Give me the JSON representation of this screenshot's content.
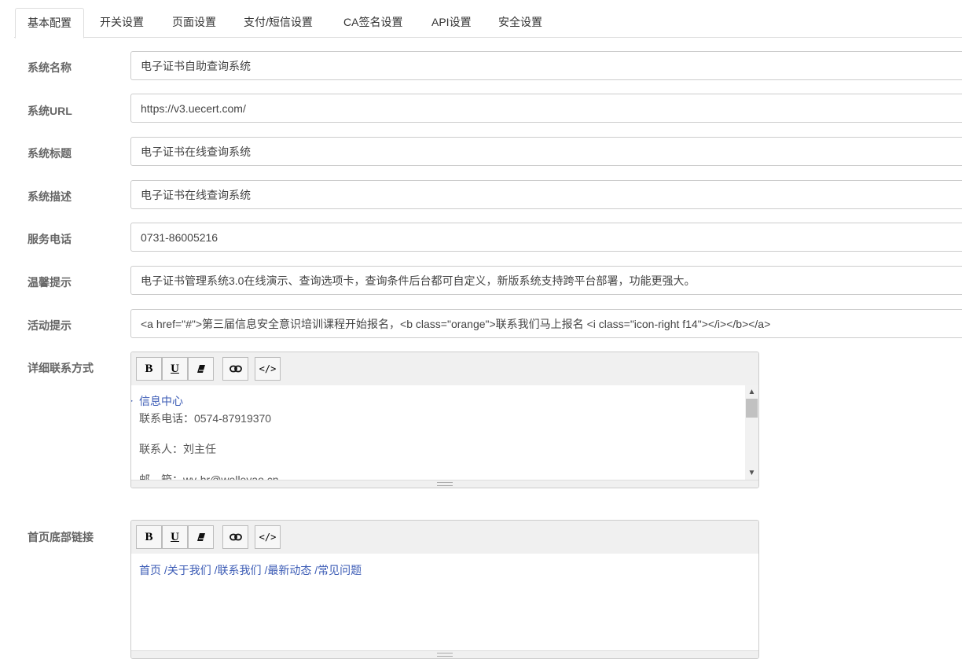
{
  "tabs": [
    "基本配置",
    "开关设置",
    "页面设置",
    "支付/短信设置",
    "CA签名设置",
    "API设置",
    "安全设置"
  ],
  "fields": {
    "system_name": {
      "label": "系统名称",
      "value": "电子证书自助查询系统"
    },
    "system_url": {
      "label": "系统URL",
      "value": "https://v3.uecert.com/"
    },
    "system_title": {
      "label": "系统标题",
      "value": "电子证书在线查询系统"
    },
    "system_desc": {
      "label": "系统描述",
      "value": "电子证书在线查询系统"
    },
    "service_phone": {
      "label": "服务电话",
      "value": "0731-86005216"
    },
    "tips": {
      "label": "温馨提示",
      "value": "电子证书管理系统3.0在线演示、查询选项卡，查询条件后台都可自定义，新版系统支持跨平台部署，功能更强大。"
    },
    "activity": {
      "label": "活动提示",
      "value": "<a href=\"#\">第三届信息安全意识培训课程开始报名，<b class=\"orange\">联系我们马上报名 <i class=\"icon-right f14\"></i></b></a>"
    }
  },
  "contact_editor": {
    "label": "详细联系方式",
    "heading": "信息中心",
    "phone": "联系电话：0574-87919370",
    "person": "联系人：刘主任",
    "email": "邮　箱：wy-hr@welleyao.cn"
  },
  "footer_editor": {
    "label": "首页底部链接",
    "links": [
      "首页",
      "/关于我们",
      "/联系我们",
      "/最新动态",
      "/常见问题"
    ]
  },
  "toolbar": {
    "bold": "B",
    "underline": "U"
  }
}
